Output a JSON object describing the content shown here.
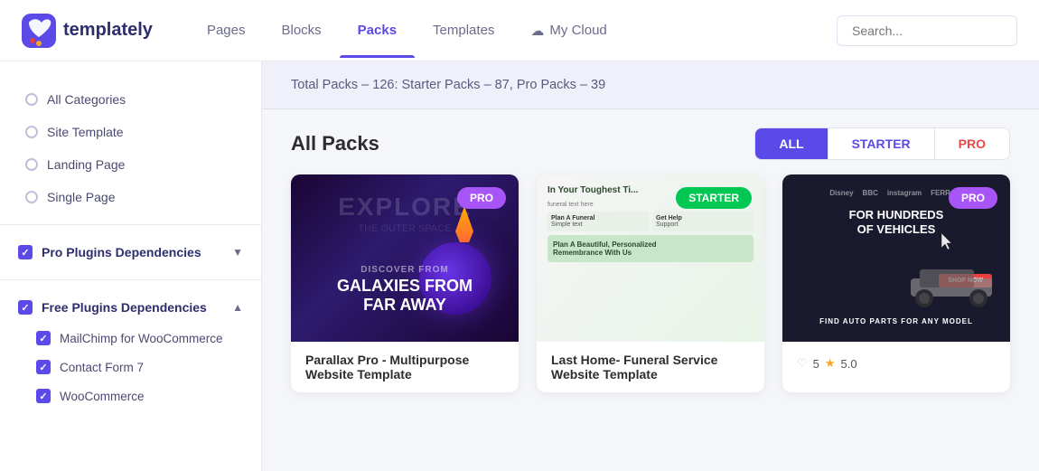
{
  "header": {
    "logo_text": "templately",
    "nav": [
      {
        "label": "Pages",
        "active": false
      },
      {
        "label": "Blocks",
        "active": false
      },
      {
        "label": "Packs",
        "active": true
      },
      {
        "label": "Templates",
        "active": false
      },
      {
        "label": "My Cloud",
        "active": false
      }
    ],
    "search_placeholder": "Search..."
  },
  "stats": {
    "text": "Total Packs – ",
    "total": "126",
    "starter_label": ": Starter Packs – ",
    "starter": "87",
    "pro_label": ", Pro Packs – ",
    "pro": "39",
    "full_text": "Total Packs – 126: Starter Packs – 87, Pro Packs – 39"
  },
  "sidebar": {
    "categories": [
      {
        "label": "All Categories",
        "selected": false
      },
      {
        "label": "Site Template",
        "selected": false
      },
      {
        "label": "Landing Page",
        "selected": false
      },
      {
        "label": "Single Page",
        "selected": false
      }
    ],
    "pro_plugins": {
      "label": "Pro Plugins Dependencies",
      "collapsed": true,
      "chevron": "▼"
    },
    "free_plugins": {
      "label": "Free Plugins Dependencies",
      "expanded": true,
      "chevron": "▲",
      "items": [
        {
          "label": "MailChimp for WooCommerce"
        },
        {
          "label": "Contact Form 7"
        },
        {
          "label": "WooCommerce"
        }
      ]
    }
  },
  "main": {
    "title": "All Packs",
    "filters": [
      {
        "label": "ALL",
        "active": true
      },
      {
        "label": "STARTER",
        "active": false
      },
      {
        "label": "PRO",
        "active": false
      }
    ],
    "cards": [
      {
        "badge": "PRO",
        "badge_type": "pro",
        "title": "Parallax Pro - Multipurpose Website Template",
        "has_rating": false,
        "bg_type": "parallax"
      },
      {
        "badge": "STARTER",
        "badge_type": "starter",
        "title": "Last Home- Funeral Service Website Template",
        "has_rating": false,
        "bg_type": "funeral"
      },
      {
        "badge": "PRO",
        "badge_type": "pro",
        "title": "",
        "has_rating": true,
        "rating_count": "5",
        "rating_value": "5.0",
        "bg_type": "auto"
      }
    ]
  },
  "icons": {
    "cloud": "☁",
    "heart": "♡",
    "star": "★",
    "search": "🔍"
  }
}
